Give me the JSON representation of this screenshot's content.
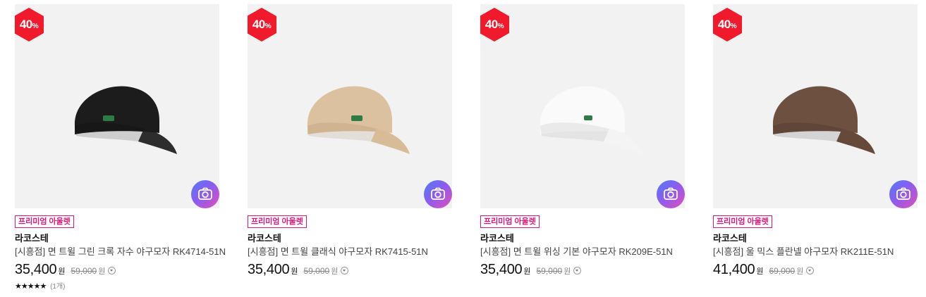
{
  "colors": {
    "badge_red": "#f01a2c",
    "tag_pink": "#e0157a",
    "thumb_bg": "#f2f2f2"
  },
  "products": [
    {
      "discount": "40",
      "discount_unit": "%",
      "tag": "프리미엄 아울렛",
      "brand": "라코스테",
      "name": "[시흥점] 면 트윌 그린 크록 자수 야구모자 RK4714-51N",
      "price": "35,400",
      "price_unit": "원",
      "original_price": "59,000",
      "original_unit": "원",
      "cap_color": "#1c1c1c",
      "rating_stars": "★★★★★",
      "rating_count": "(1개)"
    },
    {
      "discount": "40",
      "discount_unit": "%",
      "tag": "프리미엄 아울렛",
      "brand": "라코스테",
      "name": "[시흥점] 면 트윌 클래식 야구모자 RK7415-51N",
      "price": "35,400",
      "price_unit": "원",
      "original_price": "59,000",
      "original_unit": "원",
      "cap_color": "#dcc1a0"
    },
    {
      "discount": "40",
      "discount_unit": "%",
      "tag": "프리미엄 아울렛",
      "brand": "라코스테",
      "name": "[시흥점] 면 트윌 위싱 기본 야구모자 RK209E-51N",
      "price": "35,400",
      "price_unit": "원",
      "original_price": "59,000",
      "original_unit": "원",
      "cap_color": "#fafafa"
    },
    {
      "discount": "40",
      "discount_unit": "%",
      "tag": "프리미엄 아울렛",
      "brand": "라코스테",
      "name": "[시흥점] 울 믹스 플란넬 야구모자 RK211E-51N",
      "price": "41,400",
      "price_unit": "원",
      "original_price": "69,000",
      "original_unit": "원",
      "cap_color": "#6e5040"
    }
  ],
  "icons": {
    "lens": "camera-lens-search-icon",
    "info": "chevron-down-circle-icon"
  }
}
